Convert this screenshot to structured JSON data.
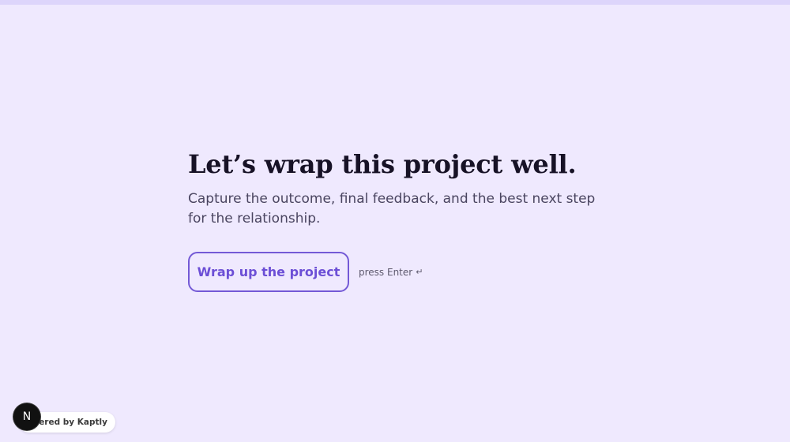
{
  "page": {
    "headline": "Let’s wrap this project well.",
    "subtitle": "Capture the outcome, final feedback, and the best next step for the relationship."
  },
  "actions": {
    "primary_label": "Wrap up the project",
    "hint_text": "press Enter",
    "hint_icon": "↵"
  },
  "footer": {
    "powered_by": "Powered by Kaptly",
    "badge_letter": "N"
  },
  "colors": {
    "background": "#efe9fe",
    "accent": "#7359d6",
    "heading": "#171226"
  }
}
